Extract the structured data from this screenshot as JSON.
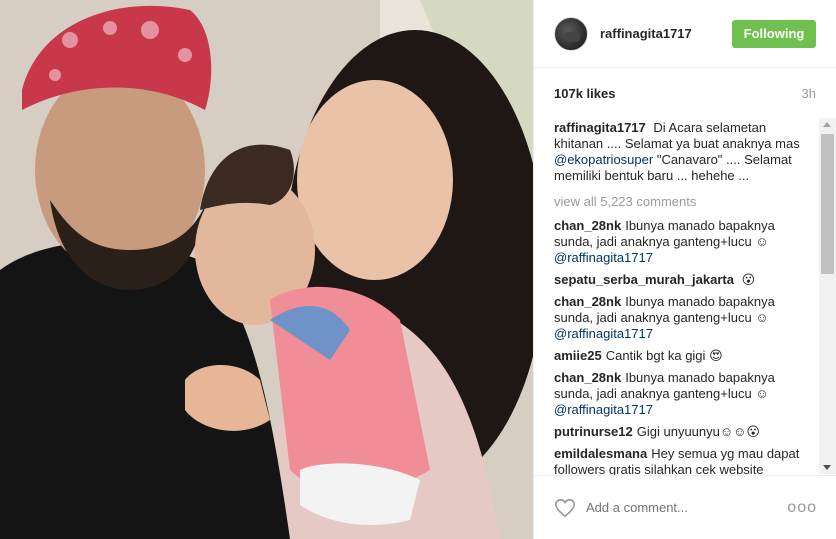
{
  "post": {
    "username": "raffinagita1717",
    "follow_label": "Following",
    "likes": "107k likes",
    "time": "3h",
    "caption_user": "raffinagita1717",
    "caption_part1": "Di Acara selametan khitanan .... Selamat ya buat anaknya mas",
    "caption_mention": "@ekopatriosuper",
    "caption_part2": "\"Canavaro\" .... Selamat memiliki bentuk baru ... hehehe ...",
    "view_all": "view all 5,223 comments"
  },
  "comments": [
    {
      "user": "chan_28nk",
      "text": "Ibunya manado bapaknya sunda, jadi anaknya ganteng+lucu",
      "emoji": "☺",
      "mention": "@raffinagita1717"
    },
    {
      "user": "sepatu_serba_murah_jakarta",
      "text": "",
      "emoji": "😮",
      "mention": ""
    },
    {
      "user": "chan_28nk",
      "text": "Ibunya manado bapaknya sunda, jadi anaknya ganteng+lucu",
      "emoji": "☺",
      "mention": "@raffinagita1717"
    },
    {
      "user": "amiie25",
      "text": "Cantik bgt ka gigi",
      "emoji": "😍",
      "mention": ""
    },
    {
      "user": "chan_28nk",
      "text": "Ibunya manado bapaknya sunda, jadi anaknya ganteng+lucu",
      "emoji": "☺",
      "mention": "@raffinagita1717"
    },
    {
      "user": "putrinurse12",
      "text": "Gigi unyuunyu",
      "emoji": "☺☺😮",
      "mention": ""
    },
    {
      "user": "emildalesmana",
      "text": "Hey semua yg mau dapat followers gratis silahkan cek website",
      "emoji": "",
      "mention": ""
    }
  ],
  "footer": {
    "comment_placeholder": "Add a comment...",
    "more": "ooo"
  },
  "icons": {
    "heart": "heart-icon",
    "more": "more-options-icon"
  },
  "colors": {
    "follow_button": "#70c050",
    "mention": "#003569",
    "muted": "#999999"
  }
}
